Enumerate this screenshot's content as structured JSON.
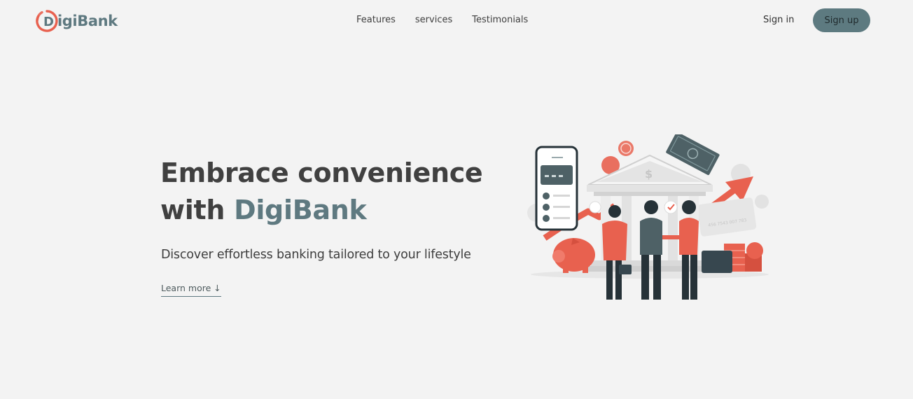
{
  "brand": {
    "logo_letter": "D",
    "name": "igiBank",
    "accent_color": "#e8614f",
    "primary_color": "#5e7980"
  },
  "nav": {
    "links": [
      "Features",
      "services",
      "Testimonials"
    ],
    "signin_label": "Sign in",
    "signup_label": "Sign up"
  },
  "hero": {
    "title_line1": "Embrace convenience",
    "title_line2_prefix": "with ",
    "title_brand": "DigiBank",
    "subtitle": "Discover effortless banking tailored to your lifestyle",
    "learn_more": "Learn more ↓"
  },
  "illustration": {
    "bank_symbol": "$",
    "card_number": "456 7543 007 783"
  }
}
